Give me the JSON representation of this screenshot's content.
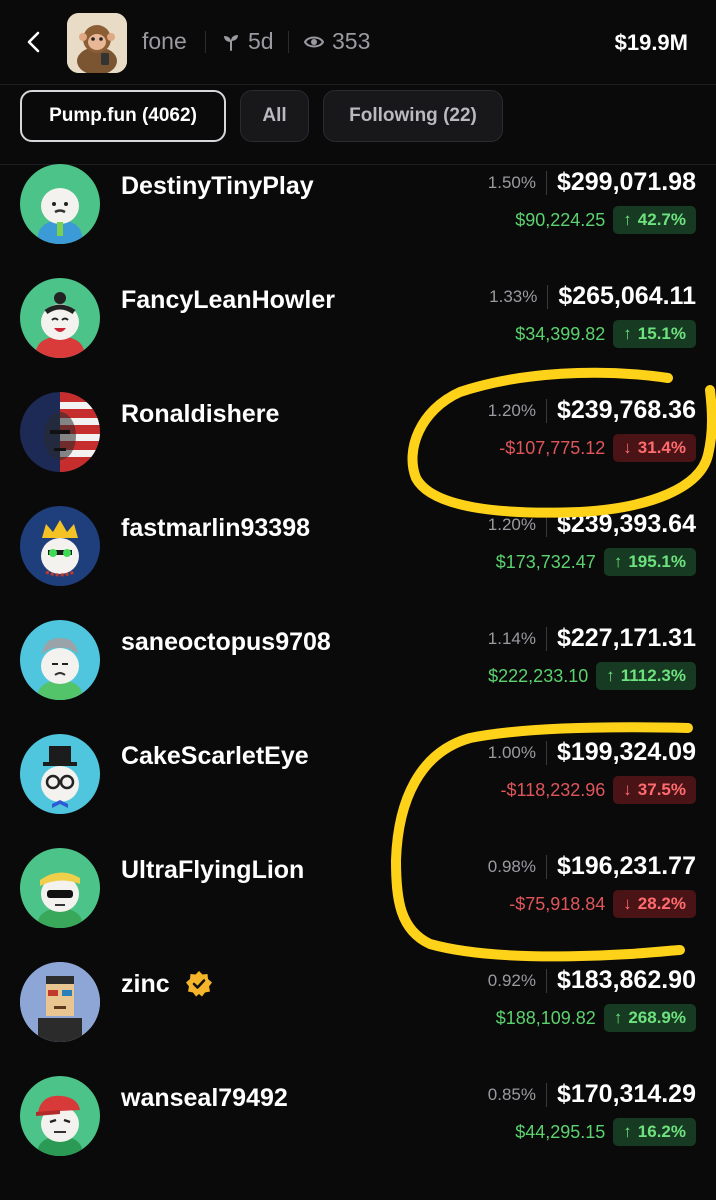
{
  "header": {
    "token_name": "fone",
    "age": "5d",
    "viewers": "353",
    "market_cap": "$19.9M"
  },
  "tabs": [
    {
      "label": "Pump.fun (4062)",
      "active": true
    },
    {
      "label": "All",
      "active": false
    },
    {
      "label": "Following (22)",
      "active": false
    }
  ],
  "holders": [
    {
      "name": "DestinyTinyPlay",
      "percent": "1.50%",
      "value": "$299,071.98",
      "pnl": "$90,224.25",
      "change": "42.7%",
      "direction": "up"
    },
    {
      "name": "FancyLeanHowler",
      "percent": "1.33%",
      "value": "$265,064.11",
      "pnl": "$34,399.82",
      "change": "15.1%",
      "direction": "up"
    },
    {
      "name": "Ronaldishere",
      "percent": "1.20%",
      "value": "$239,768.36",
      "pnl": "-$107,775.12",
      "change": "31.4%",
      "direction": "down"
    },
    {
      "name": "fastmarlin93398",
      "percent": "1.20%",
      "value": "$239,393.64",
      "pnl": "$173,732.47",
      "change": "195.1%",
      "direction": "up"
    },
    {
      "name": "saneoctopus9708",
      "percent": "1.14%",
      "value": "$227,171.31",
      "pnl": "$222,233.10",
      "change": "1112.3%",
      "direction": "up"
    },
    {
      "name": "CakeScarletEye",
      "percent": "1.00%",
      "value": "$199,324.09",
      "pnl": "-$118,232.96",
      "change": "37.5%",
      "direction": "down"
    },
    {
      "name": "UltraFlyingLion",
      "percent": "0.98%",
      "value": "$196,231.77",
      "pnl": "-$75,918.84",
      "change": "28.2%",
      "direction": "down"
    },
    {
      "name": "zinc",
      "percent": "0.92%",
      "value": "$183,862.90",
      "pnl": "$188,109.82",
      "change": "268.9%",
      "direction": "up",
      "verified": true
    },
    {
      "name": "wanseal79492",
      "percent": "0.85%",
      "value": "$170,314.29",
      "pnl": "$44,295.15",
      "change": "16.2%",
      "direction": "up"
    }
  ],
  "colors": {
    "background": "#0a0a0b",
    "positive": "#5bd26e",
    "negative": "#e0555a",
    "highlight_marker": "#ffd21a"
  }
}
